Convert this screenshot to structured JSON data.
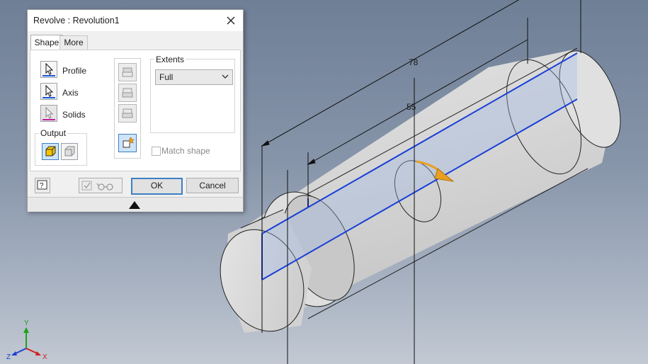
{
  "dialog": {
    "title": "Revolve : Revolution1",
    "tabs": [
      "Shape",
      "More"
    ],
    "selectors": [
      {
        "label": "Profile",
        "accent": "#1a56d6"
      },
      {
        "label": "Axis",
        "accent": "#1a56d6"
      },
      {
        "label": "Solids",
        "accent": "#c0239a"
      }
    ],
    "output_label": "Output",
    "extents": {
      "label": "Extents",
      "value": "Full"
    },
    "match_shape": "Match shape",
    "ok": "OK",
    "cancel": "Cancel"
  },
  "viewport": {
    "dimensions": [
      "78",
      "55"
    ],
    "axes": {
      "x": "X",
      "y": "Y",
      "z": "Z"
    }
  },
  "colors": {
    "sketch_line": "#1a3fd6",
    "arrow": "#e8a020",
    "body": "#d4d4d4",
    "dialog_accent": "#3c7fc4"
  },
  "icons": [
    "close-icon",
    "profile-cursor-icon",
    "axis-cursor-icon",
    "solids-cursor-icon",
    "solid-output-icon",
    "surface-output-icon",
    "join-icon",
    "cut-icon",
    "intersect-icon",
    "new-solid-icon",
    "help-icon",
    "preview-glasses-icon",
    "expand-chevron-icon"
  ]
}
